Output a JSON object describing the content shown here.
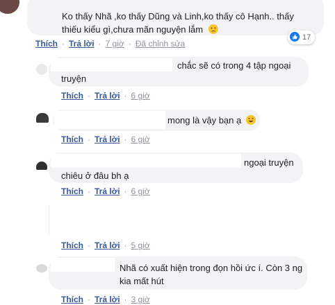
{
  "comments": [
    {
      "text_lines": [
        "Ko thấy Nhã ,ko thấy Dũng và Linh,ko thấy cô Hạnh.. thấy",
        "thiếu kiểu gì,chưa mãn nguyện lắm"
      ],
      "emoji": "disappointed-face",
      "reaction_count": "17",
      "like": "Thích",
      "reply": "Trả lời",
      "time": "7 giờ",
      "edited": "Đã chỉnh sửa"
    },
    {
      "text_lines": [
        "chắc sẽ có trong 4 tập ngoại",
        "truyện"
      ],
      "like": "Thích",
      "reply": "Trả lời",
      "time": "6 giờ"
    },
    {
      "text_lines": [
        "mong là vậy bạn ạ"
      ],
      "emoji": "grinning-face",
      "like": "Thích",
      "reply": "Trả lời",
      "time": "6 giờ"
    },
    {
      "text_lines": [
        "ngoại truyện",
        "chiêu ở đâu bh ạ"
      ],
      "like": "Thích",
      "reply": "Trả lời",
      "time": "6 giờ"
    },
    {
      "text_lines": [],
      "like": "Thích",
      "reply": "Trả lời",
      "time": "5 giờ"
    },
    {
      "text_lines": [
        "Nhã có xuất hiện trong đọn hồi ức í. Còn 3 ng",
        "kia mất hút"
      ],
      "like": "Thích",
      "reply": "Trả lời",
      "time": "3 giờ"
    }
  ],
  "colors": {
    "bubble": "#f2f3f5",
    "link": "#385898",
    "meta": "#90949c",
    "reaction_blue": "#1877f2"
  }
}
